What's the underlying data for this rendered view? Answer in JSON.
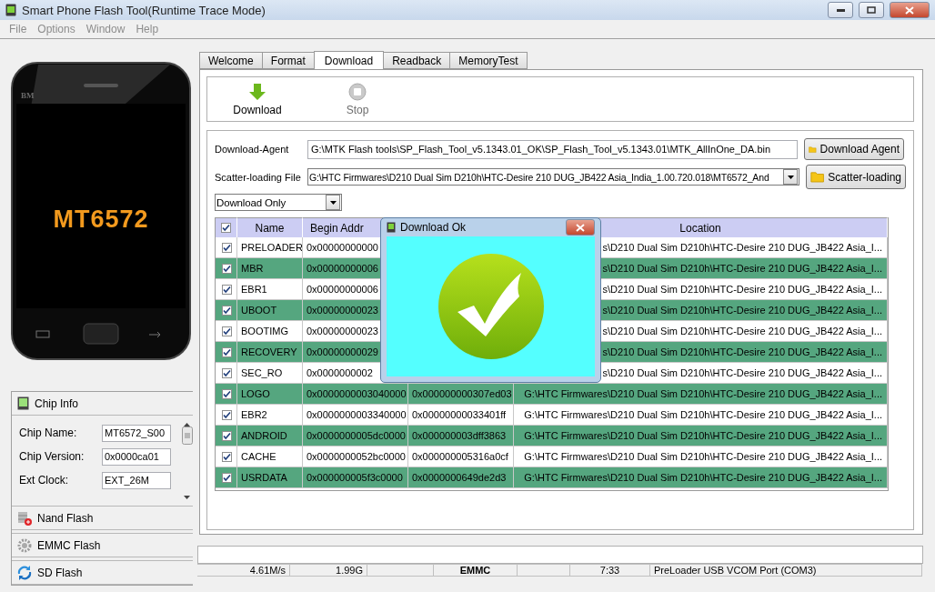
{
  "window": {
    "title": "Smart Phone Flash Tool(Runtime Trace Mode)"
  },
  "menu": [
    {
      "label": "File",
      "disabled": true
    },
    {
      "label": "Options",
      "disabled": true
    },
    {
      "label": "Window",
      "disabled": true
    },
    {
      "label": "Help",
      "disabled": true
    }
  ],
  "phone": {
    "brand": "BM",
    "chip": "MT6572"
  },
  "chip_info": {
    "title": "Chip Info",
    "fields": [
      {
        "label": "Chip Name:",
        "value": "MT6572_S00"
      },
      {
        "label": "Chip Version:",
        "value": "0x0000ca01"
      },
      {
        "label": "Ext Clock:",
        "value": "EXT_26M"
      }
    ]
  },
  "sections": [
    {
      "label": "Nand Flash",
      "kind": "nand"
    },
    {
      "label": "EMMC Flash",
      "kind": "emmc"
    },
    {
      "label": "SD Flash",
      "kind": "sd"
    }
  ],
  "tabs": [
    {
      "label": "Welcome",
      "selected": false
    },
    {
      "label": "Format",
      "selected": false
    },
    {
      "label": "Download",
      "selected": true
    },
    {
      "label": "Readback",
      "selected": false
    },
    {
      "label": "MemoryTest",
      "selected": false
    }
  ],
  "toolbar": [
    {
      "label": "Download",
      "kind": "download",
      "disabled": false
    },
    {
      "label": "Stop",
      "kind": "stop",
      "disabled": true
    }
  ],
  "download_agent": {
    "label": "Download-Agent",
    "value": "G:\\MTK Flash tools\\SP_Flash_Tool_v5.1343.01_OK\\SP_Flash_Tool_v5.1343.01\\MTK_AllInOne_DA.bin",
    "button": "Download Agent"
  },
  "scatter": {
    "label": "Scatter-loading File",
    "value": "G:\\HTC Firmwares\\D210 Dual Sim D210h\\HTC-Desire 210 DUG_JB422 Asia_India_1.00.720.018\\MT6572_And",
    "button": "Scatter-loading"
  },
  "mode": {
    "value": "Download Only"
  },
  "table": {
    "all_checked": true,
    "columns": [
      {
        "kind": "check"
      },
      {
        "kind": "text",
        "label": "Name"
      },
      {
        "kind": "text",
        "label": "Begin Addr"
      },
      {
        "kind": "blank"
      },
      {
        "kind": "text",
        "label": "Location"
      }
    ],
    "rows": [
      {
        "checked": true,
        "name": "PRELOADER",
        "begin": "0x00000000000",
        "location": "s\\D210 Dual Sim D210h\\HTC-Desire 210 DUG_JB422 Asia_I..."
      },
      {
        "checked": true,
        "name": "MBR",
        "begin": "0x00000000006",
        "location": "s\\D210 Dual Sim D210h\\HTC-Desire 210 DUG_JB422 Asia_I..."
      },
      {
        "checked": true,
        "name": "EBR1",
        "begin": "0x00000000006",
        "location": "s\\D210 Dual Sim D210h\\HTC-Desire 210 DUG_JB422 Asia_I..."
      },
      {
        "checked": true,
        "name": "UBOOT",
        "begin": "0x00000000023",
        "location": "s\\D210 Dual Sim D210h\\HTC-Desire 210 DUG_JB422 Asia_I..."
      },
      {
        "checked": true,
        "name": "BOOTIMG",
        "begin": "0x00000000023",
        "location": "s\\D210 Dual Sim D210h\\HTC-Desire 210 DUG_JB422 Asia_I..."
      },
      {
        "checked": true,
        "name": "RECOVERY",
        "begin": "0x00000000029",
        "location": "s\\D210 Dual Sim D210h\\HTC-Desire 210 DUG_JB422 Asia_I..."
      },
      {
        "checked": true,
        "name": "SEC_RO",
        "begin": "0x0000000002",
        "location": "s\\D210 Dual Sim D210h\\HTC-Desire 210 DUG_JB422 Asia_I..."
      },
      {
        "checked": true,
        "name": "LOGO",
        "begin": "0x0000000003040000",
        "end": "0x000000000307ed03",
        "location": "G:\\HTC Firmwares\\D210 Dual Sim D210h\\HTC-Desire 210 DUG_JB422 Asia_I..."
      },
      {
        "checked": true,
        "name": "EBR2",
        "begin": "0x0000000003340000",
        "end": "0x00000000033401ff",
        "location": "G:\\HTC Firmwares\\D210 Dual Sim D210h\\HTC-Desire 210 DUG_JB422 Asia_I..."
      },
      {
        "checked": true,
        "name": "ANDROID",
        "begin": "0x0000000005dc0000",
        "end": "0x000000003dff3863",
        "location": "G:\\HTC Firmwares\\D210 Dual Sim D210h\\HTC-Desire 210 DUG_JB422 Asia_I..."
      },
      {
        "checked": true,
        "name": "CACHE",
        "begin": "0x0000000052bc0000",
        "end": "0x000000005316a0cf",
        "location": "G:\\HTC Firmwares\\D210 Dual Sim D210h\\HTC-Desire 210 DUG_JB422 Asia_I..."
      },
      {
        "checked": true,
        "name": "USRDATA",
        "begin": "0x000000005f3c0000",
        "end": "0x0000000649de2d3",
        "location": "G:\\HTC Firmwares\\D210 Dual Sim D210h\\HTC-Desire 210 DUG_JB422 Asia_I..."
      }
    ]
  },
  "dialog": {
    "title": "Download Ok"
  },
  "progress": {
    "level": 0
  },
  "status_bar": [
    {
      "kind": "text",
      "text": "4.61M/s"
    },
    {
      "kind": "text",
      "text": "1.99G"
    },
    {
      "kind": "blank"
    },
    {
      "kind": "strong",
      "text": "EMMC"
    },
    {
      "kind": "blank"
    },
    {
      "kind": "text",
      "text": "7:33"
    },
    {
      "kind": "text",
      "text": "PreLoader USB VCOM Port (COM3)"
    }
  ]
}
